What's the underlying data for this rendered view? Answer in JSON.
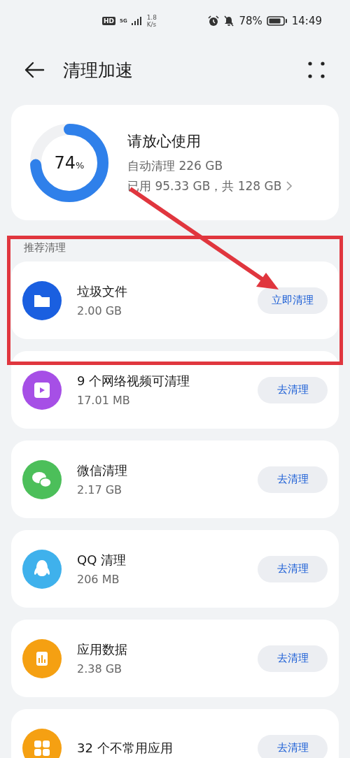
{
  "status_bar": {
    "hd": "HD",
    "network": "5G",
    "speed_value": "1.8",
    "speed_unit": "K/s",
    "battery": "78%",
    "time": "14:49"
  },
  "header": {
    "title": "清理加速"
  },
  "storage": {
    "level": 0.74,
    "percent": "74",
    "percent_unit": "%",
    "headline": "请放心使用",
    "auto_clean": "自动清理 226 GB",
    "usage": "已用 95.33 GB，共 128 GB"
  },
  "section": {
    "title": "推荐清理"
  },
  "items": [
    {
      "kind": "folder",
      "color": "#1a5fe0",
      "title": "垃圾文件",
      "size": "2.00 GB",
      "button": "立即清理"
    },
    {
      "kind": "video",
      "color": "#a64fe6",
      "title": "9 个网络视频可清理",
      "size": "17.01 MB",
      "button": "去清理"
    },
    {
      "kind": "chat",
      "color": "#4cbf5a",
      "title": "微信清理",
      "size": "2.17 GB",
      "button": "去清理"
    },
    {
      "kind": "penguin",
      "color": "#3fb1ec",
      "title": "QQ 清理",
      "size": "206 MB",
      "button": "去清理"
    },
    {
      "kind": "chart",
      "color": "#f5a012",
      "title": "应用数据",
      "size": "2.38 GB",
      "button": "去清理"
    },
    {
      "kind": "grid",
      "color": "#f5a012",
      "title": "32 个不常用应用",
      "button": "去清理"
    }
  ]
}
